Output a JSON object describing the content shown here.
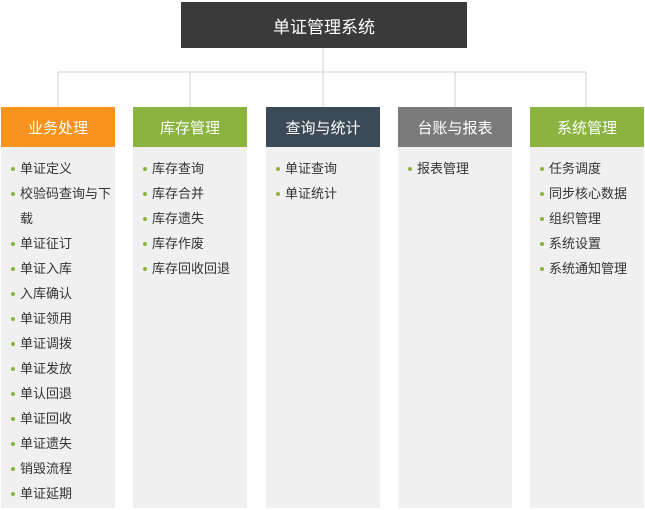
{
  "root": {
    "title": "单证管理系统"
  },
  "columns": [
    {
      "title": "业务处理",
      "color": "#f7931e",
      "items": [
        "单证定义",
        "校验码查询与下载",
        "单证征订",
        "单证入库",
        "入库确认",
        "单证领用",
        "单证调拨",
        "单证发放",
        "单认回退",
        "单证回收",
        "单证遗失",
        "销毁流程",
        "单证延期"
      ]
    },
    {
      "title": "库存管理",
      "color": "#8ab33f",
      "items": [
        "库存查询",
        "库存合并",
        "库存遗失",
        "库存作废",
        "库存回收回退"
      ]
    },
    {
      "title": "查询与统计",
      "color": "#3c4a57",
      "items": [
        "单证查询",
        "单证统计"
      ]
    },
    {
      "title": "台账与报表",
      "color": "#7b7b7b",
      "items": [
        "报表管理"
      ]
    },
    {
      "title": "系统管理",
      "color": "#8ab33f",
      "items": [
        "任务调度",
        "同步核心数据",
        "组织管理",
        "系统设置",
        "系统通知管理"
      ]
    }
  ]
}
